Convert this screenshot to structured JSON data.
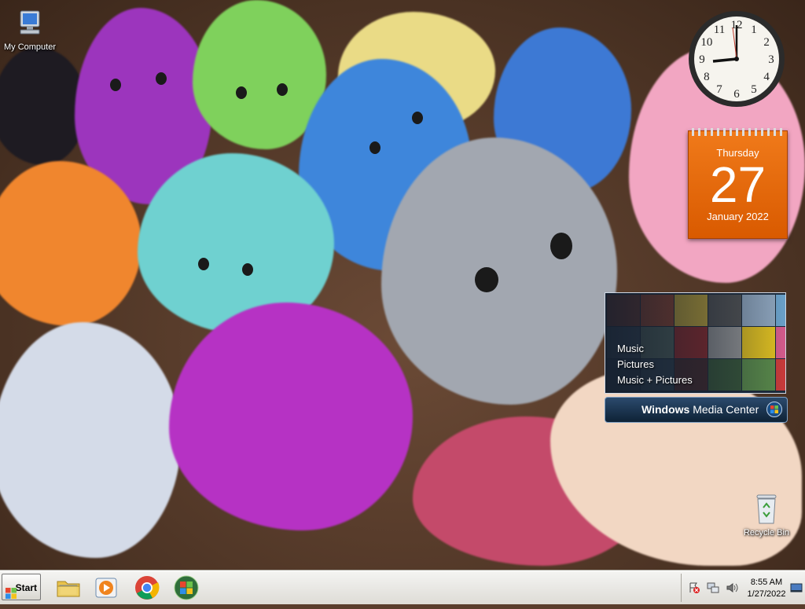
{
  "desktop": {
    "icons": [
      {
        "label": "My Computer",
        "icon": "my-computer-icon"
      },
      {
        "label": "Recycle Bin",
        "icon": "recycle-bin-icon"
      }
    ]
  },
  "gadgets": {
    "clock": {
      "time": "8:55",
      "numerals": [
        "12",
        "1",
        "2",
        "3",
        "4",
        "5",
        "6",
        "7",
        "8",
        "9",
        "10",
        "11"
      ]
    },
    "calendar": {
      "weekday": "Thursday",
      "day": "27",
      "month_year": "January 2022",
      "accent": "#e8680a"
    },
    "media_center": {
      "menu": [
        "Music",
        "Pictures",
        "Music + Pictures"
      ],
      "brand_main": "Windows",
      "brand_sub": "Media Center"
    }
  },
  "taskbar": {
    "start_label": "Start",
    "pinned": [
      {
        "name": "file-explorer",
        "icon": "folder-icon"
      },
      {
        "name": "media-player",
        "icon": "media-player-icon"
      },
      {
        "name": "chrome",
        "icon": "chrome-icon"
      },
      {
        "name": "windows-orb",
        "icon": "windows-logo-icon"
      }
    ],
    "tray": {
      "time": "8:55 AM",
      "date": "1/27/2022",
      "icons": [
        "action-center-icon",
        "network-icon",
        "volume-icon"
      ]
    }
  },
  "colors": {
    "taskbar": "#e8e6e0",
    "calendar": "#e8680a",
    "media_bar": "#1d3652"
  }
}
